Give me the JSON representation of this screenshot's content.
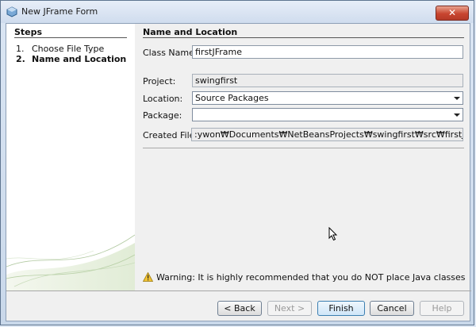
{
  "window": {
    "title": "New JFrame Form",
    "close_symbol": "✕"
  },
  "steps": {
    "title": "Steps",
    "items": [
      {
        "num": "1.",
        "label": "Choose File Type"
      },
      {
        "num": "2.",
        "label": "Name and Location"
      }
    ]
  },
  "form": {
    "section_title": "Name and Location",
    "class_name_label": "Class Name:",
    "class_name_value": "firstJFrame",
    "project_label": "Project:",
    "project_value": "swingfirst",
    "location_label": "Location:",
    "location_value": "Source Packages",
    "package_label": "Package:",
    "package_value": "",
    "created_file_label": "Created File:",
    "created_file_value": ":ywon₩Documents₩NetBeansProjects₩swingfirst₩src₩firstJFrame.java"
  },
  "warning": "Warning: It is highly recommended that you do NOT place Java classes in the def...",
  "buttons": {
    "back": "< Back",
    "next": "Next >",
    "finish": "Finish",
    "cancel": "Cancel",
    "help": "Help"
  },
  "colors": {
    "accent": "#3c7fb1",
    "warning": "#e0a800"
  }
}
